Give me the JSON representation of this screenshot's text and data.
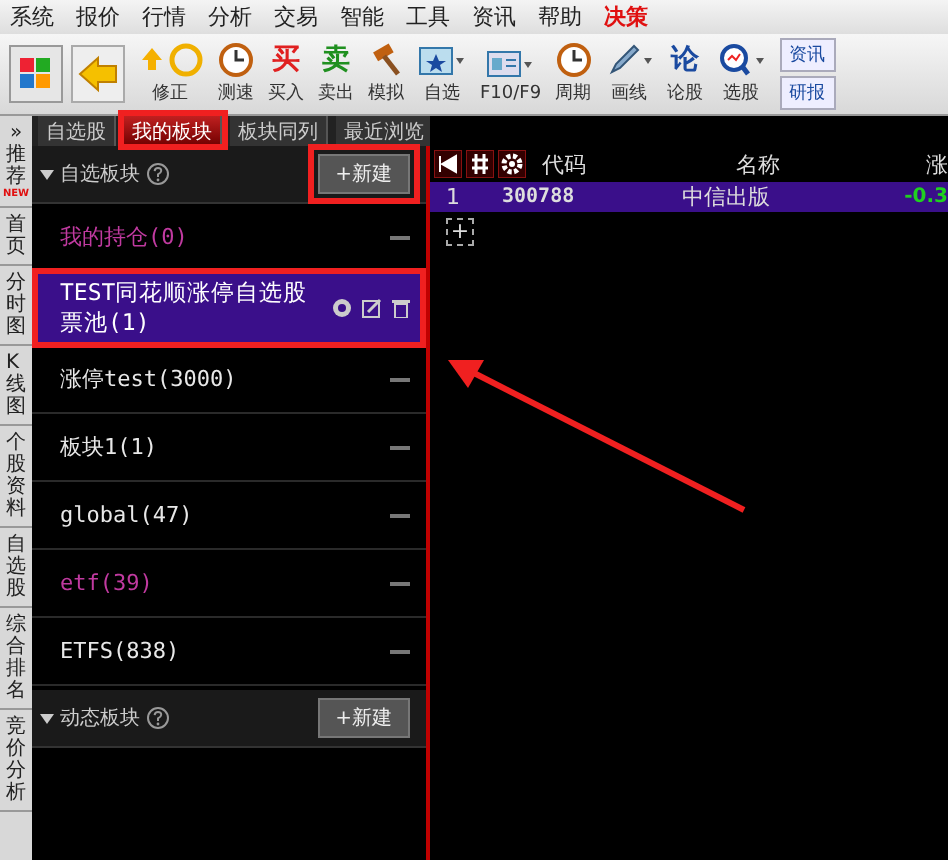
{
  "menu": [
    {
      "label": "系统",
      "kind": "normal"
    },
    {
      "label": "报价",
      "kind": "normal"
    },
    {
      "label": "行情",
      "kind": "normal"
    },
    {
      "label": "分析",
      "kind": "normal"
    },
    {
      "label": "交易",
      "kind": "normal"
    },
    {
      "label": "智能",
      "kind": "normal"
    },
    {
      "label": "工具",
      "kind": "normal"
    },
    {
      "label": "资讯",
      "kind": "normal"
    },
    {
      "label": "帮助",
      "kind": "normal"
    },
    {
      "label": "决策",
      "kind": "alert"
    }
  ],
  "toolbar": [
    {
      "kind": "updown",
      "label": "修正"
    },
    {
      "kind": "clock",
      "label": "测速"
    },
    {
      "kind": "glyph",
      "glyph": "买",
      "label": "买入",
      "color": "#e02020"
    },
    {
      "kind": "glyph",
      "glyph": "卖",
      "label": "卖出",
      "color": "#209020"
    },
    {
      "kind": "hammer",
      "label": "模拟"
    },
    {
      "kind": "folder",
      "label": "自选"
    },
    {
      "kind": "card",
      "label": "F10/F9"
    },
    {
      "kind": "clock",
      "label": "周期"
    },
    {
      "kind": "pencil",
      "label": "画线"
    },
    {
      "kind": "glyph",
      "glyph": "论",
      "label": "论股",
      "color": "#1a4aa0"
    },
    {
      "kind": "search",
      "label": "选股"
    }
  ],
  "side_buttons": [
    "资讯",
    "研报"
  ],
  "left_strip": [
    {
      "label": "推荐",
      "badge": "NEW",
      "arrow": "»"
    },
    {
      "label": "首页"
    },
    {
      "label": "分时图"
    },
    {
      "label": "K线图"
    },
    {
      "label": "个股资料"
    },
    {
      "label": "自选股"
    },
    {
      "label": "综合排名"
    },
    {
      "label": "竞价分析"
    }
  ],
  "tabs": [
    {
      "label": "自选股",
      "selected": false
    },
    {
      "label": "我的板块",
      "selected": true
    },
    {
      "label": "板块同列",
      "selected": false
    },
    {
      "label": "最近浏览",
      "selected": false
    }
  ],
  "group": {
    "title": "自选板块",
    "new_button": "+新建",
    "items": [
      {
        "label": "我的持仓(0)",
        "color": "#c03aa0",
        "selected": false
      },
      {
        "label": "TEST同花顺涨停自选股票池(1)",
        "color": "#ffffff",
        "selected": true
      },
      {
        "label": "涨停test(3000)",
        "color": "#e8e8e8",
        "selected": false
      },
      {
        "label": "板块1(1)",
        "color": "#e8e8e8",
        "selected": false
      },
      {
        "label": "global(47)",
        "color": "#e8e8e8",
        "selected": false
      },
      {
        "label": "etf(39)",
        "color": "#c03aa0",
        "selected": false
      },
      {
        "label": "ETFS(838)",
        "color": "#e8e8e8",
        "selected": false
      }
    ]
  },
  "group2": {
    "title": "动态板块",
    "new_button": "+新建"
  },
  "table": {
    "columns": [
      "代码",
      "名称",
      "涨"
    ],
    "rows": [
      {
        "index": "1",
        "code": "300788",
        "name": "中信出版",
        "change": "-0.3"
      }
    ],
    "add": "+"
  }
}
